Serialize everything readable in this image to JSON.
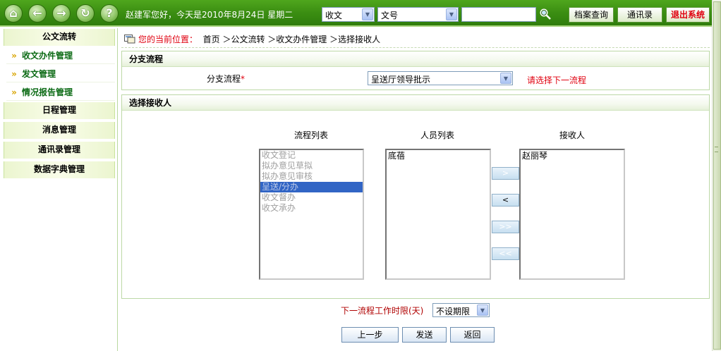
{
  "header": {
    "greeting": "赵建军您好，今天是2010年8月24日 星期二",
    "select1_value": "收文",
    "select2_value": "文号",
    "search_value": "",
    "buttons": {
      "archive": "档案查询",
      "contacts": "通讯录",
      "logout": "退出系统"
    }
  },
  "sidebar": {
    "groups": [
      {
        "title": "公文流转",
        "items": [
          "收文办件管理",
          "发文管理",
          "情况报告管理"
        ]
      },
      {
        "title": "日程管理"
      },
      {
        "title": "消息管理"
      },
      {
        "title": "通讯录管理"
      },
      {
        "title": "数据字典管理"
      }
    ]
  },
  "breadcrumb": {
    "label": "您的当前位置：",
    "path": "首页 ＞公文流转 ＞收文办件管理 ＞选择接收人"
  },
  "branch": {
    "section_title": "分支流程",
    "field_label": "分支流程",
    "required_mark": "*",
    "selected": "呈送厅领导批示",
    "hint": "请选择下一流程"
  },
  "receiver": {
    "section_title": "选择接收人",
    "process_list_title": "流程列表",
    "person_list_title": "人员列表",
    "receiver_list_title": "接收人",
    "process_list": [
      "收文登记",
      "拟办意见草拟",
      "拟办意见审核",
      "呈送/分办",
      "收文督办",
      "收文承办"
    ],
    "process_selected_index": 3,
    "person_list": [
      "底蓓"
    ],
    "receiver_list": [
      "赵丽琴"
    ],
    "buttons": {
      "add": ">",
      "remove": "<",
      "add_all": ">>",
      "remove_all": "<<"
    }
  },
  "deadline": {
    "label": "下一流程工作时限(天)",
    "selected": "不设期限"
  },
  "actions": {
    "prev": "上一步",
    "send": "发送",
    "back": "返回"
  },
  "colors": {
    "accent_green": "#3b8e12",
    "alert_red": "#e0000f",
    "selection_blue": "#3165c5"
  }
}
